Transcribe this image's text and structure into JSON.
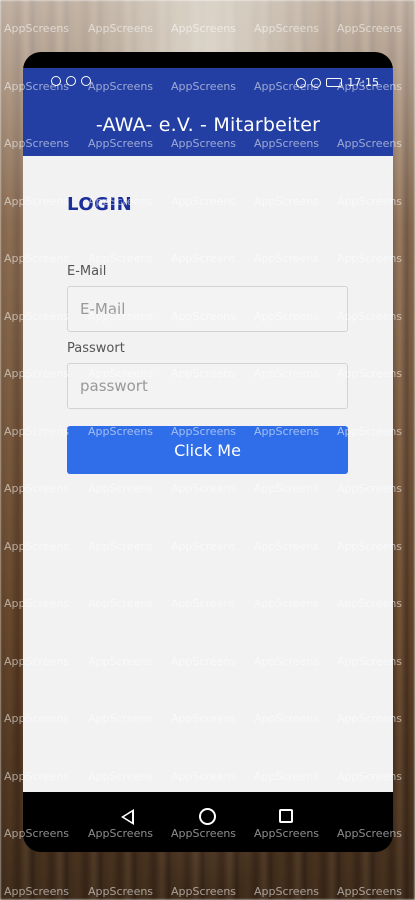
{
  "statusbar": {
    "time": "17:15"
  },
  "appbar": {
    "title": "-AWA- e.V. - Mitarbeiter"
  },
  "login": {
    "heading": "LOGIN",
    "email_label": "E-Mail",
    "email_placeholder": "E-Mail",
    "email_value": "",
    "password_label": "Passwort",
    "password_placeholder": "passwort",
    "password_value": "",
    "button_label": "Click Me"
  },
  "navbar": {
    "icons": [
      "back-icon",
      "home-icon",
      "recent-apps-icon"
    ]
  },
  "watermark": {
    "text": "AppScreens"
  },
  "colors": {
    "appbar": "#243fa3",
    "heading": "#1b2e9a",
    "button": "#2f6ee8",
    "screen_bg": "#f2f2f2"
  }
}
